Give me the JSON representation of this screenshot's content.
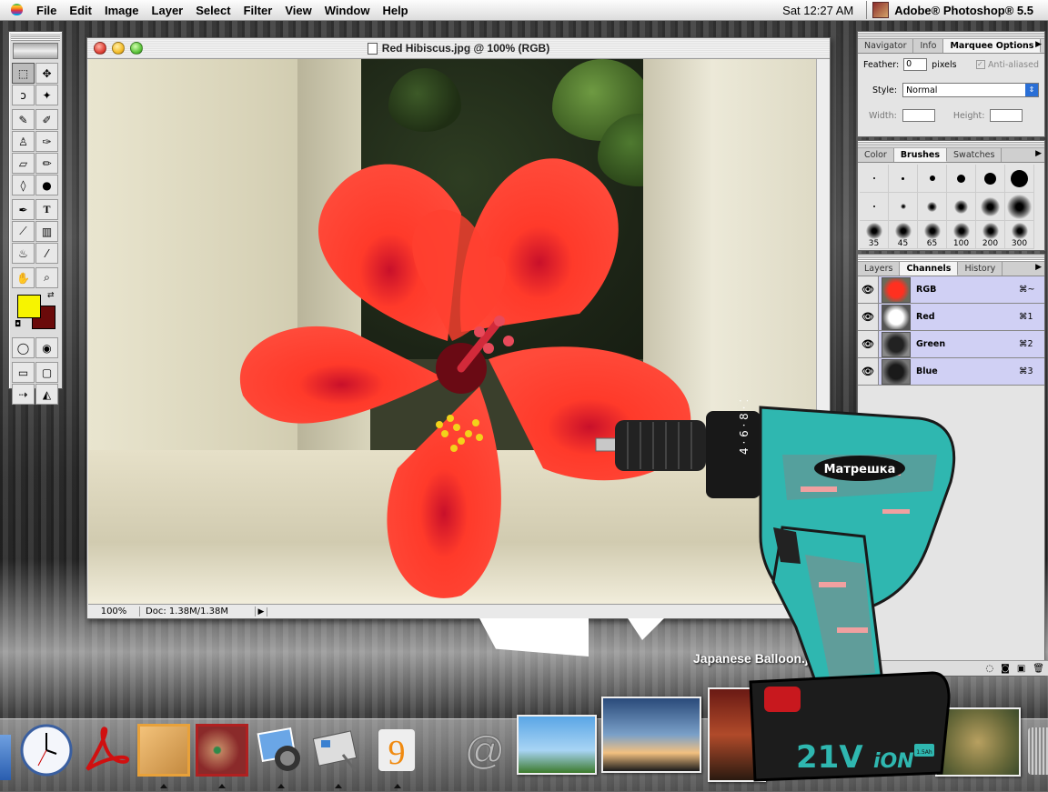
{
  "menubar": {
    "items": [
      "File",
      "Edit",
      "Image",
      "Layer",
      "Select",
      "Filter",
      "View",
      "Window",
      "Help"
    ],
    "clock": "Sat 12:27 AM",
    "app_name": "Adobe® Photoshop® 5.5"
  },
  "tools": {
    "foreground_color": "#f7f400",
    "background_color": "#6a0a0a"
  },
  "document": {
    "title": "Red Hibiscus.jpg @ 100% (RGB)",
    "zoom": "100%",
    "doc_size": "Doc: 1.38M/1.38M"
  },
  "marquee_palette": {
    "tabs": [
      "Navigator",
      "Info",
      "Marquee Options"
    ],
    "feather_label": "Feather:",
    "feather_value": "0",
    "feather_unit": "pixels",
    "anti_aliased": "Anti-aliased",
    "style_label": "Style:",
    "style_value": "Normal",
    "width_label": "Width:",
    "height_label": "Height:"
  },
  "brushes_palette": {
    "tabs": [
      "Color",
      "Brushes",
      "Swatches"
    ],
    "large_sizes": [
      "35",
      "45",
      "65",
      "100",
      "200",
      "300"
    ]
  },
  "layers_palette": {
    "tabs": [
      "Layers",
      "Channels",
      "History"
    ],
    "channels": [
      {
        "name": "RGB",
        "shortcut": "⌘~"
      },
      {
        "name": "Red",
        "shortcut": "⌘1"
      },
      {
        "name": "Green",
        "shortcut": "⌘2"
      },
      {
        "name": "Blue",
        "shortcut": "⌘3"
      }
    ]
  },
  "desktop": {
    "file_label": "Japanese Balloon.jpg"
  },
  "drill": {
    "brand": "Матрешка",
    "voltage": "21V",
    "battery": "iON",
    "capacity": "1.5Ah"
  }
}
